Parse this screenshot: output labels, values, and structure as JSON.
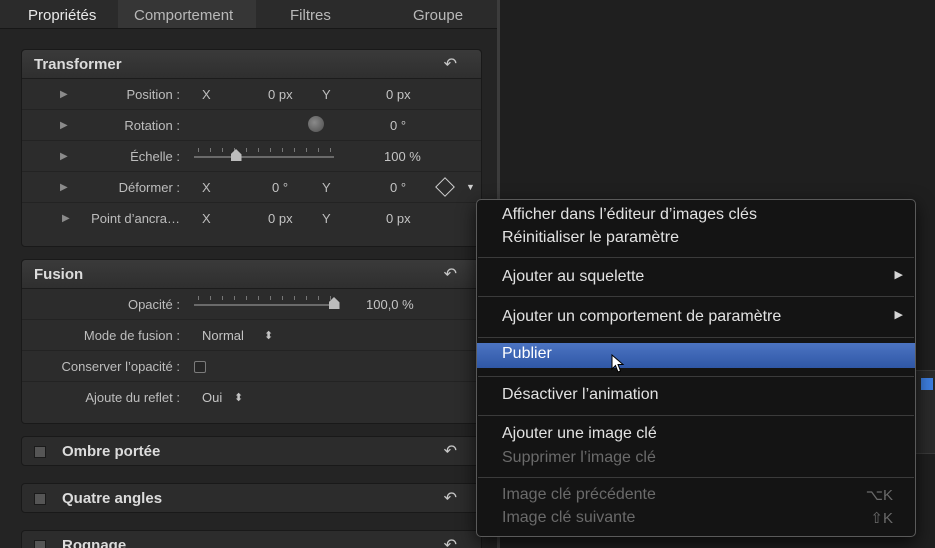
{
  "tabs": [
    "Propriétés",
    "Comportement",
    "Filtres",
    "Groupe"
  ],
  "transformer": {
    "title": "Transformer",
    "position": {
      "label": "Position :",
      "x_axis": "X",
      "x_value": "0 px",
      "y_axis": "Y",
      "y_value": "0 px"
    },
    "rotation": {
      "label": "Rotation :",
      "value": "0 °"
    },
    "scale": {
      "label": "Échelle :",
      "value": "100 %",
      "slider_fraction": 0.3
    },
    "skew": {
      "label": "Déformer :",
      "x_axis": "X",
      "x_value": "0 °",
      "y_axis": "Y",
      "y_value": "0 °"
    },
    "anchor": {
      "label": "Point d’ancra…",
      "x_axis": "X",
      "x_value": "0 px",
      "y_axis": "Y",
      "y_value": "0 px"
    }
  },
  "fusion": {
    "title": "Fusion",
    "opacity": {
      "label": "Opacité :",
      "value": "100,0 %",
      "slider_fraction": 1.0
    },
    "blend_mode": {
      "label": "Mode de fusion :",
      "value": "Normal"
    },
    "preserve_opacity": {
      "label": "Conserver l’opacité :",
      "checked": false
    },
    "reflection": {
      "label": "Ajoute du reflet :",
      "value": "Oui"
    }
  },
  "collapsed_sections": [
    "Ombre portée",
    "Quatre angles",
    "Rognage"
  ],
  "context_menu": {
    "group1": [
      "Afficher dans l’éditeur d’images clés",
      "Réinitialiser le paramètre"
    ],
    "add_rig": "Ajouter au squelette",
    "add_behavior": "Ajouter un comportement de paramètre",
    "publish": "Publier",
    "disable_animation": "Désactiver l’animation",
    "add_keyframe": "Ajouter une image clé",
    "delete_keyframe": "Supprimer l’image clé",
    "prev_keyframe": "Image clé précédente",
    "prev_shortcut": "⌥K",
    "next_keyframe": "Image clé suivante",
    "next_shortcut": "⇧K"
  },
  "colors": {
    "menu_highlight": "#3b63b3",
    "panel": "#242424",
    "accent_icon": "#3d7ee0"
  }
}
